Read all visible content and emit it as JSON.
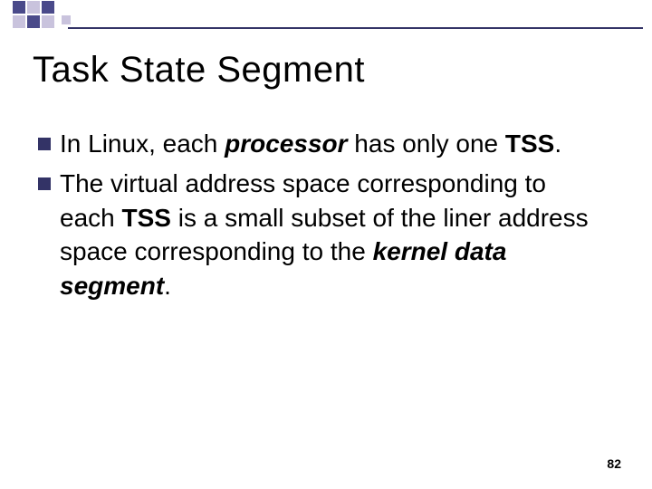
{
  "title": "Task State Segment",
  "bullets": [
    {
      "t1": "In Linux, each ",
      "t2_bi": "processor",
      "t3": " has only one ",
      "t4_b": "TSS",
      "t5": "."
    },
    {
      "t1": "The virtual address space corresponding to each ",
      "t2_b": "TSS",
      "t3": " is a small subset of the liner address space corresponding to the ",
      "t4_bi": "kernel data segment",
      "t5": "."
    }
  ],
  "page_number": "82"
}
